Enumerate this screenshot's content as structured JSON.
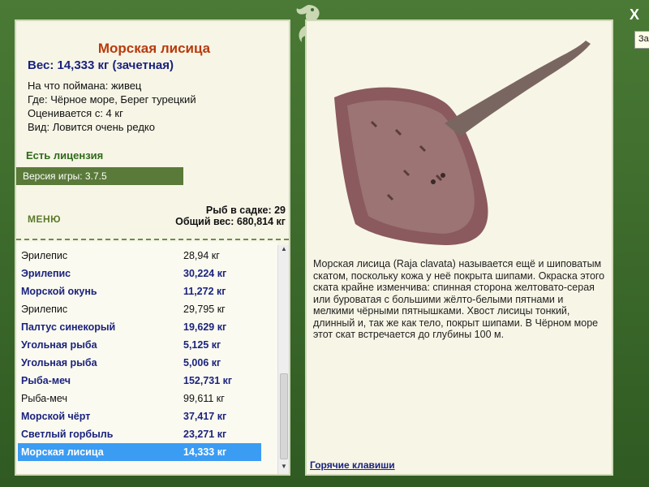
{
  "catch": {
    "title": "Морская лисица",
    "weight": "Вес: 14,333 кг (зачетная)",
    "lines": [
      "На что поймана: живец",
      "Где: Чёрное море, Берег турецкий",
      "Оценивается с: 4 кг",
      "Вид: Ловится очень редко"
    ],
    "license": "Есть лицензия",
    "version": "Версия игры: 3.7.5"
  },
  "menu": {
    "label": "МЕНЮ"
  },
  "stats": {
    "count": "Рыб в садке: 29",
    "total": "Общий вес: 680,814 кг"
  },
  "fish_list": [
    {
      "name": "Эрилепис",
      "value": "28,94 кг",
      "bold": false,
      "selected": false
    },
    {
      "name": "Эрилепис",
      "value": "30,224 кг",
      "bold": true,
      "selected": false
    },
    {
      "name": "Морской окунь",
      "value": "11,272 кг",
      "bold": true,
      "selected": false
    },
    {
      "name": "Эрилепис",
      "value": "29,795 кг",
      "bold": false,
      "selected": false
    },
    {
      "name": "Палтус синекорый",
      "value": "19,629 кг",
      "bold": true,
      "selected": false
    },
    {
      "name": "Угольная рыба",
      "value": "5,125 кг",
      "bold": true,
      "selected": false
    },
    {
      "name": "Угольная рыба",
      "value": "5,006 кг",
      "bold": true,
      "selected": false
    },
    {
      "name": "Рыба-меч",
      "value": "152,731 кг",
      "bold": true,
      "selected": false
    },
    {
      "name": "Рыба-меч",
      "value": "99,611 кг",
      "bold": false,
      "selected": false
    },
    {
      "name": "Морской чёрт",
      "value": "37,417 кг",
      "bold": true,
      "selected": false
    },
    {
      "name": "Светлый горбыль",
      "value": "23,271 кг",
      "bold": true,
      "selected": false
    },
    {
      "name": "Морская лисица",
      "value": "14,333 кг",
      "bold": true,
      "selected": true
    }
  ],
  "description": "Морская лисица (Raja clavata) называется ещё и шиповатым скатом, поскольку кожа у неё покрыта шипами. Окраска этого ската крайне изменчива: спинная сторона желтовато-серая или буроватая с большими жёлто-белыми пятнами и мелкими чёрными пятнышками. Хвост лисицы тонкий, длинный и, так же как тело, покрыт шипами. В Чёрном море этот скат встречается до глубины 100 м.",
  "hotkeys": "Горячие клавиши",
  "close": "X",
  "side_tab": "За",
  "colors": {
    "frame": "#3f6b2e",
    "panel": "#f7f5e6",
    "accent_title": "#b83a0c",
    "bold_text": "#1a237e",
    "selection": "#3b9cf3"
  },
  "icons": {
    "logo": "fish-logo-icon",
    "close": "close-icon",
    "scroll_up": "scroll-up-icon",
    "scroll_down": "scroll-down-icon"
  }
}
